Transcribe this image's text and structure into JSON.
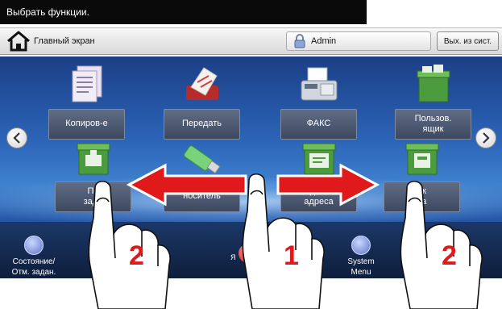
{
  "top_message": "Выбрать функции.",
  "header": {
    "home_label": "Главный экран",
    "user_label": "Admin",
    "logout_label": "Вых. из сист."
  },
  "tiles_row1": [
    {
      "label": "Копиров-е",
      "icon": "copy-documents-icon"
    },
    {
      "label": "Передать",
      "icon": "send-icon"
    },
    {
      "label": "ФАКС",
      "icon": "fax-icon"
    },
    {
      "label": "Пользов.\nящик",
      "icon": "custom-box-icon"
    }
  ],
  "tiles_row2": [
    {
      "label": "По\nзада",
      "icon": "job-box-icon"
    },
    {
      "label": "носитель",
      "icon": "usb-drive-icon"
    },
    {
      "label": "доп.\nадреса",
      "icon": "address-box-icon"
    },
    {
      "label": "ик\nса",
      "icon": "fax-box-icon"
    }
  ],
  "bottom_bar": {
    "status_label": "Состояние/\nОтм. задан.",
    "partial_label": "Я",
    "system_menu_label": "System\nMenu"
  },
  "gesture_steps": {
    "left": "2",
    "center": "1",
    "right": "2"
  },
  "colors": {
    "arrow_red": "#e0191b",
    "screen_blue": "#2c64b8",
    "tile_label_bg": "#4a566d"
  }
}
